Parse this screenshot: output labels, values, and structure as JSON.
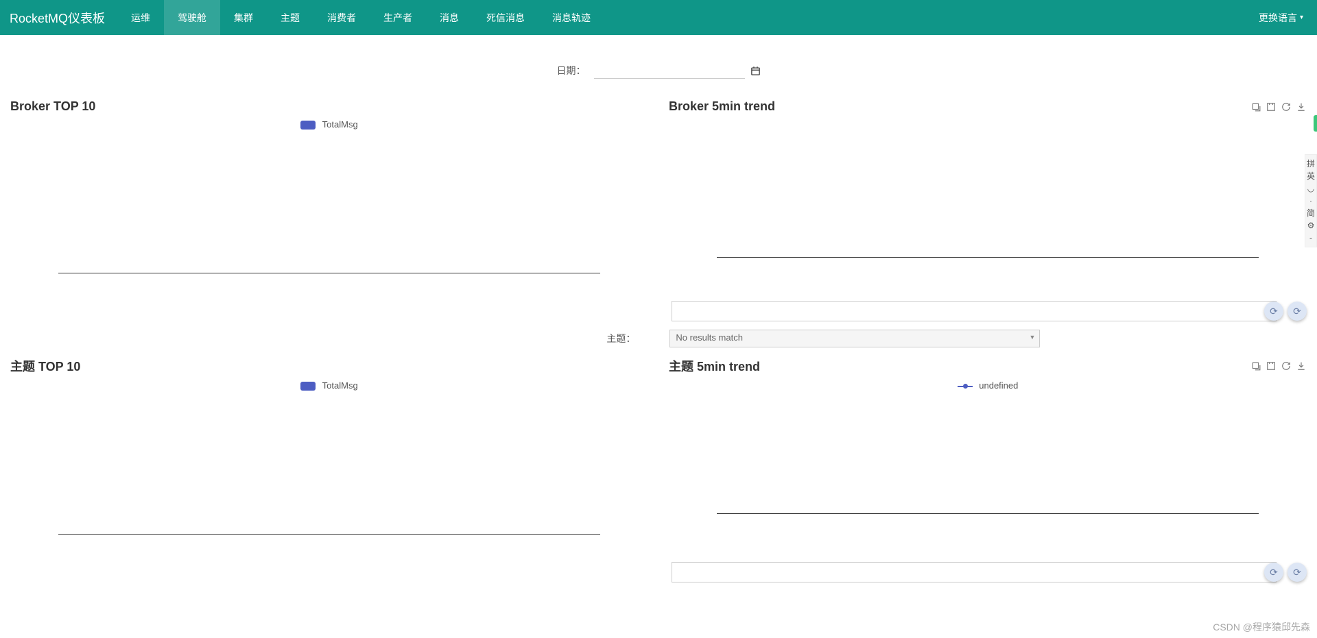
{
  "navbar": {
    "brand": "RocketMQ仪表板",
    "items": [
      "运维",
      "驾驶舱",
      "集群",
      "主题",
      "消费者",
      "生产者",
      "消息",
      "死信消息",
      "消息轨迹"
    ],
    "active_index": 1,
    "language_label": "更换语言"
  },
  "date": {
    "label": "日期：",
    "value": ""
  },
  "panels": {
    "broker_top10": {
      "title": "Broker TOP 10",
      "legend": "TotalMsg"
    },
    "broker_trend": {
      "title": "Broker 5min trend"
    },
    "topic_top10": {
      "title": "主题 TOP 10",
      "legend": "TotalMsg"
    },
    "topic_trend": {
      "title": "主题 5min trend",
      "legend": "undefined"
    }
  },
  "topic_filter": {
    "label": "主题：",
    "search_value": "",
    "select_text": "No results match"
  },
  "chart_data": [
    {
      "id": "broker_top10",
      "type": "bar",
      "categories": [],
      "series": [
        {
          "name": "TotalMsg",
          "values": []
        }
      ],
      "xlabel": "",
      "ylabel": ""
    },
    {
      "id": "broker_trend",
      "type": "line",
      "x": [],
      "series": [],
      "xlabel": "",
      "ylabel": ""
    },
    {
      "id": "topic_top10",
      "type": "bar",
      "categories": [],
      "series": [
        {
          "name": "TotalMsg",
          "values": []
        }
      ],
      "xlabel": "",
      "ylabel": ""
    },
    {
      "id": "topic_trend",
      "type": "line",
      "x": [],
      "series": [
        {
          "name": "undefined",
          "values": []
        }
      ],
      "xlabel": "",
      "ylabel": ""
    }
  ],
  "sidebar_hints": [
    "拼",
    "英",
    "◡",
    "·",
    "简",
    "⚙",
    "-"
  ],
  "watermark": "CSDN @程序猿邱先森"
}
